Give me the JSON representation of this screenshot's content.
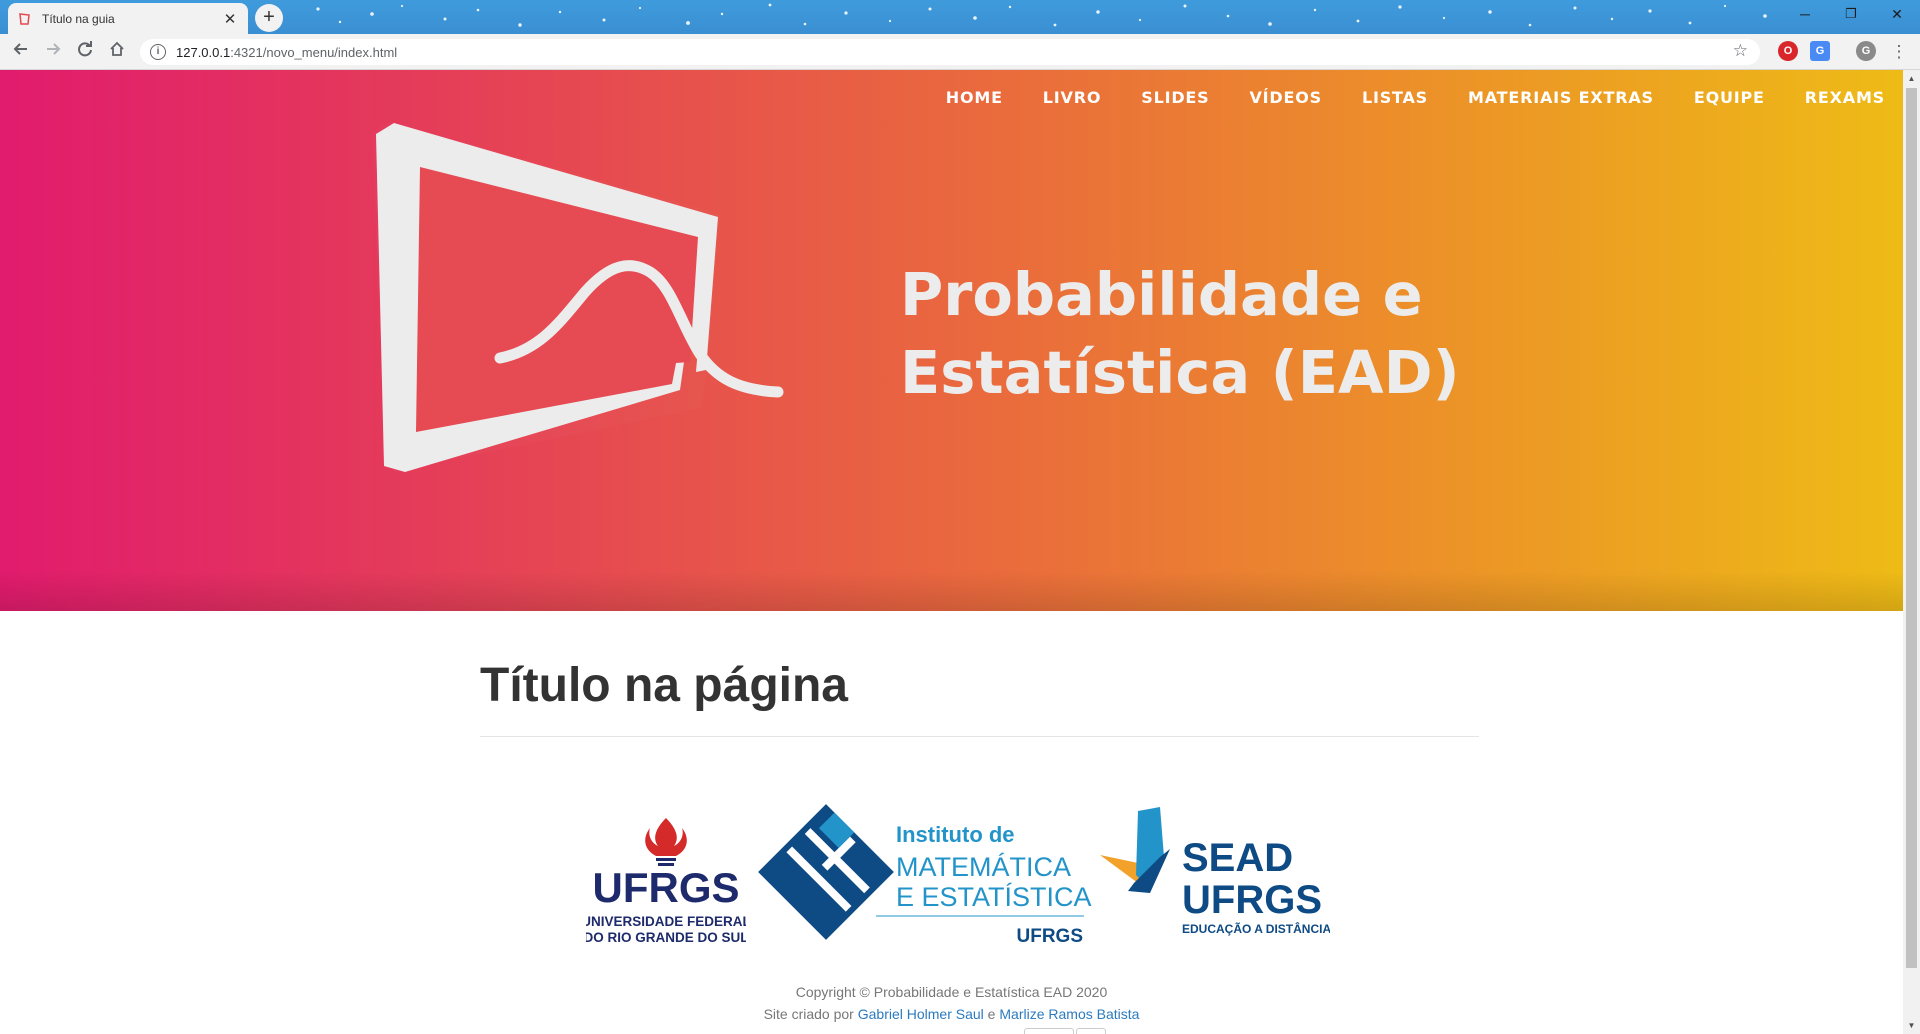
{
  "browser": {
    "tab_title": "Título na guia",
    "tab_close": "✕",
    "new_tab": "+",
    "url_host": "127.0.0.1",
    "url_rest": ":4321/novo_menu/index.html",
    "profile_initial": "G",
    "window_minimize": "─",
    "window_restore": "❐",
    "window_close": "✕"
  },
  "nav": {
    "items": [
      {
        "label": "HOME"
      },
      {
        "label": "LIVRO"
      },
      {
        "label": "SLIDES"
      },
      {
        "label": "VÍDEOS"
      },
      {
        "label": "LISTAS"
      },
      {
        "label": "MATERIAIS EXTRAS"
      },
      {
        "label": "EQUIPE"
      },
      {
        "label": "REXAMS"
      }
    ]
  },
  "hero": {
    "title_line1": "Probabilidade e",
    "title_line2": "Estatística (EAD)",
    "gradient_colors": [
      "#e11b6d",
      "#e64852",
      "#ea6f3a",
      "#ec9626",
      "#eebb16"
    ]
  },
  "main": {
    "page_title": "Título na página"
  },
  "logos": {
    "ufrgs": {
      "name": "UFRGS",
      "line1": "UNIVERSIDADE FEDERAL",
      "line2": "DO RIO GRANDE DO SUL"
    },
    "ime": {
      "line1": "Instituto de",
      "line2": "MATEMÁTICA",
      "line3": "E ESTATÍSTICA",
      "line4": "UFRGS"
    },
    "sead": {
      "line1": "SEAD",
      "line2": "UFRGS",
      "line3": "EDUCAÇÃO A DISTÂNCIA"
    }
  },
  "footer": {
    "copyright": "Copyright © Probabilidade e Estatística EAD 2020",
    "credits_prefix": "Site criado por ",
    "author1": "Gabriel Holmer Saul",
    "credits_join": " e ",
    "author2": "Marlize Ramos Batista"
  }
}
